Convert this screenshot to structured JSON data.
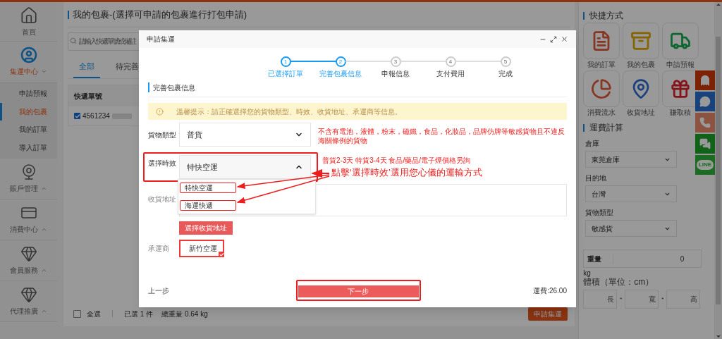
{
  "sidebar": {
    "home": {
      "label": "首頁",
      "kind": "home"
    },
    "groups": [
      {
        "label": "集運中心",
        "kind": "person",
        "active": true,
        "expanded": true,
        "children": [
          {
            "label": "申請預報",
            "selected": false
          },
          {
            "label": "我的包裹",
            "selected": true
          },
          {
            "label": "我的訂單",
            "selected": false
          },
          {
            "label": "導入訂單",
            "selected": false
          }
        ]
      },
      {
        "label": "賬戶管理",
        "kind": "webcam",
        "active": false,
        "expanded": false
      },
      {
        "label": "消費中心",
        "kind": "card",
        "active": false,
        "expanded": false
      },
      {
        "label": "會員服務",
        "kind": "gem",
        "active": false,
        "expanded": false
      },
      {
        "label": "代理推廣",
        "kind": "gem",
        "active": false,
        "expanded": false
      }
    ]
  },
  "main": {
    "title": "我的包裹-(選擇可申請的包裹進行打包申請)",
    "search": {
      "placeholder": "請輸入快遞單號或備註"
    },
    "tabs": [
      {
        "label": "全部",
        "selected": true
      },
      {
        "label": "待完善",
        "selected": false
      }
    ],
    "table": {
      "columns": [
        "快遞單號"
      ],
      "rows": [
        {
          "checked": true,
          "cells": [
            "4561234"
          ]
        }
      ]
    },
    "footer": {
      "select_all": {
        "label": "全選",
        "checked": false
      },
      "selected_count": "已選 1 件",
      "total_weight": "總重量 0.64 kg",
      "button": "申請集運"
    }
  },
  "right_panel": {
    "shortcuts_title": "快捷方式",
    "shortcuts": [
      {
        "kind": "order",
        "label": "我的訂單"
      },
      {
        "kind": "package",
        "label": "我的包裹"
      },
      {
        "kind": "truck",
        "label": "申請預報"
      },
      {
        "kind": "pie",
        "label": "消費流水"
      },
      {
        "kind": "pin",
        "label": "收貨地址"
      },
      {
        "kind": "gift",
        "label": "賺取積"
      }
    ],
    "calculator_title": "運費計算",
    "selects": [
      {
        "label": "倉庫",
        "value": "東莞倉庫"
      },
      {
        "label": "目的地",
        "value": "台灣"
      },
      {
        "label": "貨物類型",
        "value": "敏感貨"
      }
    ],
    "weight": {
      "label": "重量",
      "value": "0",
      "unit": "kg"
    },
    "volume": {
      "label": "體積（單位：cm）",
      "fields": [
        {
          "placeholder": "長"
        },
        {
          "placeholder": "寬"
        },
        {
          "placeholder": "高"
        }
      ],
      "separator": "*"
    }
  },
  "contacts": [
    {
      "kind": "qq"
    },
    {
      "kind": "chat"
    },
    {
      "kind": "phone"
    },
    {
      "kind": "wechat"
    },
    {
      "kind": "line",
      "label": "LINE"
    }
  ],
  "modal": {
    "title": "申請集運",
    "steps": [
      {
        "number": "1",
        "label": "已選擇訂單",
        "active": true
      },
      {
        "number": "2",
        "label": "完善包裹信息",
        "active": true
      },
      {
        "number": "3",
        "label": "申報信息",
        "active": false
      },
      {
        "number": "4",
        "label": "支付費用",
        "active": false
      },
      {
        "number": "5",
        "label": "完成",
        "active": false
      }
    ],
    "section_title": "完善包裹信息",
    "notice": "溫馨提示：請正確選擇您的貨物類型、時效、收貨地址、承運商等信息。",
    "cargo_type": {
      "label": "貨物類型",
      "value": "普貨",
      "expanded": false,
      "hint": "不含有電池，液體，粉末，磁鐵，食品，化妝品，品牌仿牌等敏感貨物且不違反海關條例的貨物"
    },
    "timing": {
      "label": "選擇時效",
      "value": "特快空運",
      "expanded": true,
      "hint": "普貨2-3天 特貨3-4天 食品/藥品/電子煙價格另詢",
      "options": [
        {
          "label": "特快空運"
        },
        {
          "label": "海運快遞"
        }
      ]
    },
    "annotation": "點擊‘選擇時效’選用您心儀的運輸方式",
    "address": {
      "label": "收貨地址",
      "button": "選擇收貨地址"
    },
    "carrier": {
      "label": "承運商",
      "options": [
        {
          "label": "新竹空運",
          "selected": true
        }
      ]
    },
    "prev": "上一步",
    "next": "下一步",
    "fee": "運費:26.00"
  }
}
